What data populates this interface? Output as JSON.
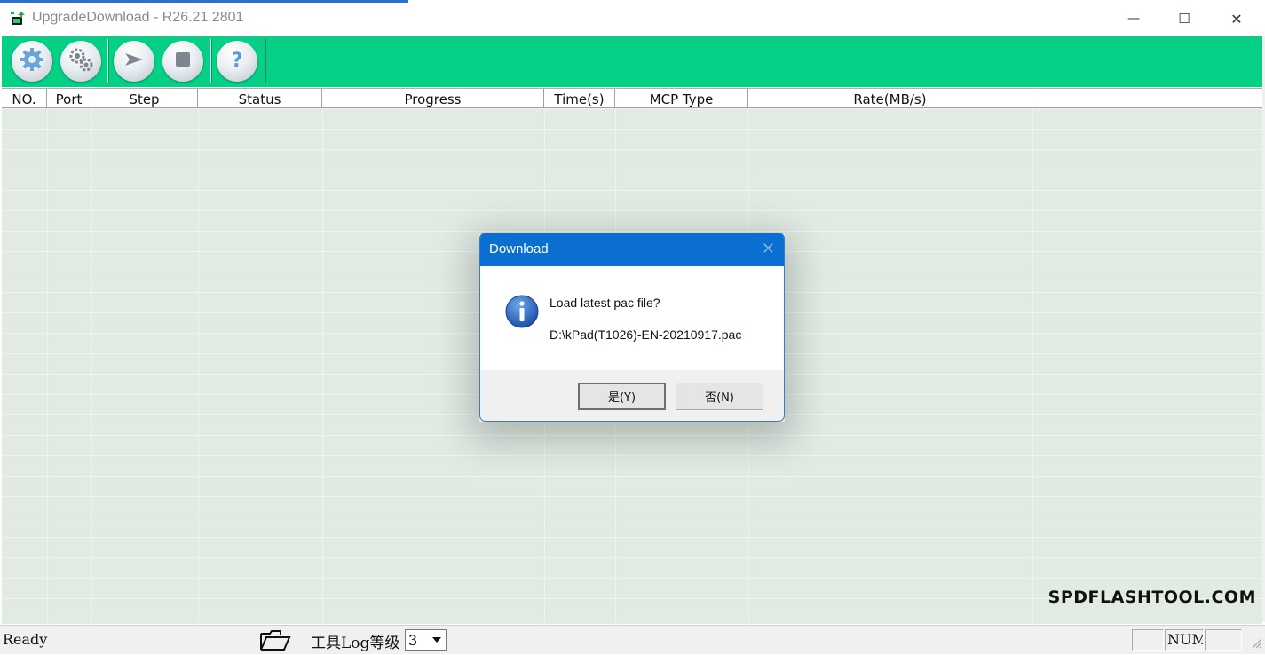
{
  "window": {
    "title": "UpgradeDownload - R26.21.2801",
    "controls": {
      "minimize": "—",
      "maximize": "☐",
      "close": "✕"
    }
  },
  "toolbar": {
    "buttons": [
      {
        "name": "settings",
        "icon": "gear-icon"
      },
      {
        "name": "advanced-settings",
        "icon": "gears-icon"
      },
      {
        "name": "start",
        "icon": "play-icon"
      },
      {
        "name": "stop",
        "icon": "stop-icon"
      },
      {
        "name": "help",
        "icon": "help-icon"
      }
    ],
    "background": "#06cf86"
  },
  "table": {
    "columns": [
      "NO.",
      "Port",
      "Step",
      "Status",
      "Progress",
      "Time(s)",
      "MCP Type",
      "Rate(MB/s)"
    ],
    "rows": []
  },
  "watermark": "SPDFLASHTOOL.COM",
  "statusbar": {
    "status": "Ready",
    "log_level_label": "工具Log等级",
    "log_level_value": "3",
    "num_indicator": "NUM"
  },
  "dialog": {
    "title": "Download",
    "message": "Load latest pac file?",
    "file_path": "D:\\kPad(T1026)-EN-20210917.pac",
    "yes_label": "是(Y)",
    "no_label": "否(N)",
    "title_color": "#0a6fd1"
  }
}
